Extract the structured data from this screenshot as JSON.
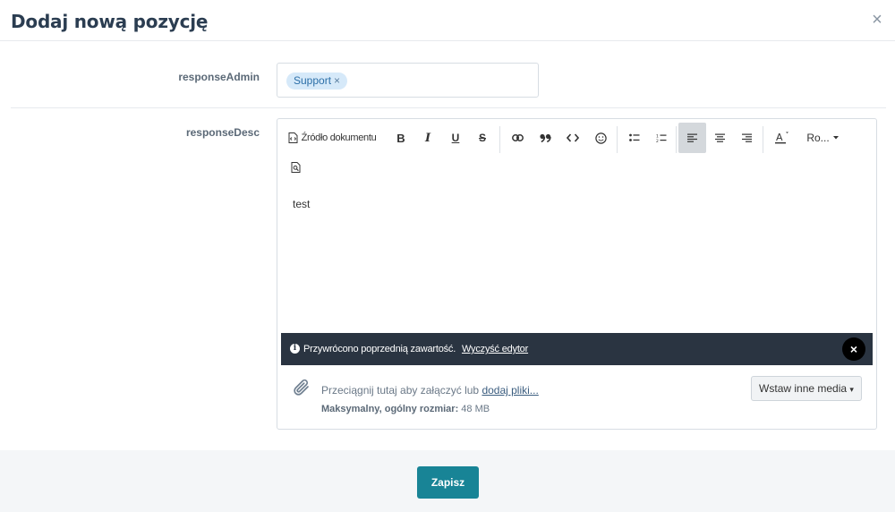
{
  "modal": {
    "title": "Dodaj nową pozycję",
    "close_glyph": "×"
  },
  "fields": {
    "admin_label": "responseAdmin",
    "desc_label": "responseDesc",
    "admin_tags": [
      {
        "label": "Support",
        "remove": "×"
      }
    ]
  },
  "toolbar": {
    "source_label": "Źródło dokumentu",
    "bold": "B",
    "italic": "I",
    "underline": "U",
    "strike": "S",
    "font_label": "Ro...",
    "icons": [
      "document-source-icon",
      "bold-icon",
      "italic-icon",
      "underline-icon",
      "strikethrough-icon",
      "link-icon",
      "blockquote-icon",
      "code-icon",
      "emoji-icon",
      "bulleted-list-icon",
      "numbered-list-icon",
      "align-left-icon",
      "align-center-icon",
      "align-right-icon",
      "font-color-icon",
      "font-family-dropdown",
      "preview-icon"
    ]
  },
  "editor": {
    "content": "test"
  },
  "notice": {
    "message": "Przywrócono poprzednią zawartość.",
    "clear_label": "Wyczyść edytor",
    "close_glyph": "×"
  },
  "attachments": {
    "drop_text": "Przeciągnij tutaj aby załączyć lub",
    "add_link": "dodaj pliki...",
    "max_label": "Maksymalny, ogólny rozmiar:",
    "max_value": "48 MB",
    "media_button": "Wstaw inne media"
  },
  "footer": {
    "save_label": "Zapisz"
  },
  "colors": {
    "accent": "#188496",
    "notice_bg": "#2a3441",
    "tag_bg": "#d6e9f9"
  }
}
